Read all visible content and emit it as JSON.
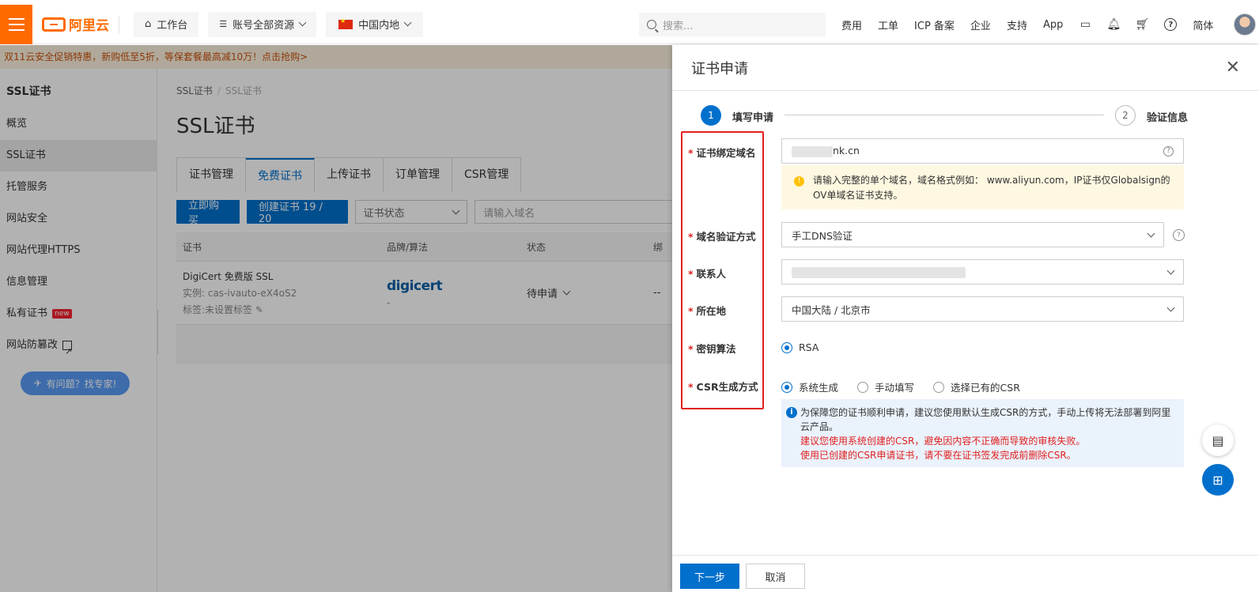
{
  "topbar": {
    "logo_text": "阿里云",
    "workbench": "工作台",
    "account_resources": "账号全部资源",
    "region": "中国内地",
    "search_placeholder": "搜索...",
    "links": [
      "费用",
      "工单",
      "ICP 备案",
      "企业",
      "支持",
      "App"
    ],
    "lang": "简体"
  },
  "promo": "双11云安全促销特惠，新购低至5折，等保套餐最高减10万！点击抢购>",
  "sidebar": {
    "title": "SSL证书",
    "items": [
      "概览",
      "SSL证书",
      "托管服务",
      "网站安全",
      "网站代理HTTPS",
      "信息管理",
      "私有证书",
      "网站防篡改"
    ],
    "new_badge": "new",
    "help": "有问题？找专家!"
  },
  "main": {
    "breadcrumb": [
      "SSL证书",
      "SSL证书"
    ],
    "title": "SSL证书",
    "tabs": [
      "证书管理",
      "免费证书",
      "上传证书",
      "订单管理",
      "CSR管理"
    ],
    "buy_button": "立即购买",
    "create_button": "创建证书 19 / 20",
    "status_filter": "证书状态",
    "domain_placeholder": "请输入域名",
    "columns": [
      "证书",
      "品牌/算法",
      "状态",
      "绑"
    ],
    "row": {
      "name": "DigiCert 免费版 SSL",
      "instance": "实例: cas-ivauto-eX4oS2",
      "tags": "标签:未设置标签",
      "brand": "digicert",
      "algo": "-",
      "status": "待申请",
      "bind": "--"
    }
  },
  "drawer": {
    "title": "证书申请",
    "step1": "填写申请",
    "step2": "验证信息",
    "step1_num": "1",
    "step2_num": "2",
    "labels": {
      "domain": "证书绑定域名",
      "verify": "域名验证方式",
      "contact": "联系人",
      "location": "所在地",
      "algorithm": "密钥算法",
      "csr": "CSR生成方式"
    },
    "domain_value": "nk.cn",
    "domain_hint": "请输入完整的单个域名，域名格式例如： www.aliyun.com，IP证书仅Globalsign的OV单域名证书支持。",
    "verify_value": "手工DNS验证",
    "location_value": "中国大陆 / 北京市",
    "algorithm_option": "RSA",
    "csr_options": [
      "系统生成",
      "手动填写",
      "选择已有的CSR"
    ],
    "info_line1": "为保障您的证书顺利申请，建议您使用默认生成CSR的方式，手动上传将无法部署到阿里云产品。",
    "info_line2": "建议您使用系统创建的CSR，避免因内容不正确而导致的审核失败。",
    "info_line3": "使用已创建的CSR申请证书，请不要在证书签发完成前删除CSR。",
    "next_button": "下一步",
    "cancel_button": "取消"
  }
}
